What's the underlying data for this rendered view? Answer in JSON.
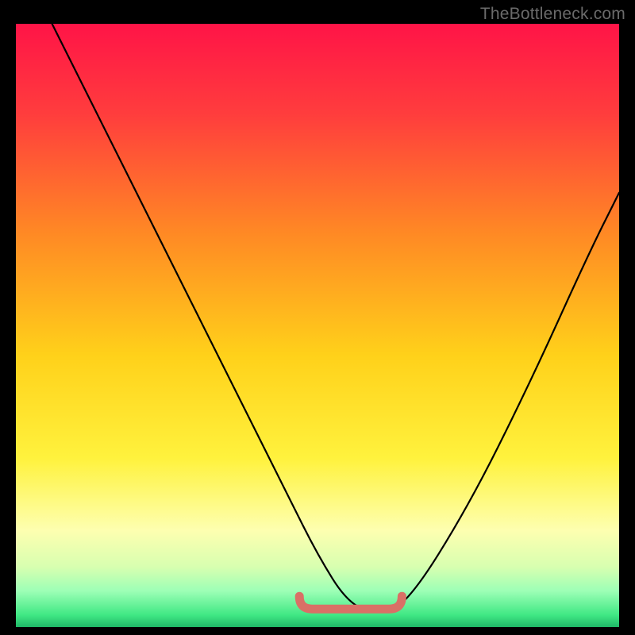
{
  "watermark": {
    "text": "TheBottleneck.com"
  },
  "chart_data": {
    "type": "line",
    "title": "",
    "xlabel": "",
    "ylabel": "",
    "xlim": [
      0,
      100
    ],
    "ylim": [
      0,
      100
    ],
    "series": [
      {
        "name": "curve",
        "x": [
          6,
          15,
          25,
          35,
          45,
          50,
          55,
          60,
          65,
          75,
          85,
          95,
          100
        ],
        "values": [
          100,
          82,
          62,
          42,
          22,
          12,
          4,
          2,
          4,
          20,
          40,
          62,
          72
        ]
      }
    ],
    "marker_band": {
      "name": "bottom-marker",
      "x0": 47,
      "x1": 64,
      "y": 3
    },
    "background": {
      "type": "vertical-gradient",
      "stops": [
        {
          "offset": 0.0,
          "color": "#ff1447"
        },
        {
          "offset": 0.15,
          "color": "#ff3d3d"
        },
        {
          "offset": 0.35,
          "color": "#ff8a24"
        },
        {
          "offset": 0.55,
          "color": "#ffd11a"
        },
        {
          "offset": 0.72,
          "color": "#fff23d"
        },
        {
          "offset": 0.84,
          "color": "#fdffb0"
        },
        {
          "offset": 0.9,
          "color": "#d8ffb0"
        },
        {
          "offset": 0.94,
          "color": "#9dffb6"
        },
        {
          "offset": 0.98,
          "color": "#40e884"
        },
        {
          "offset": 1.0,
          "color": "#1fb867"
        }
      ]
    }
  }
}
